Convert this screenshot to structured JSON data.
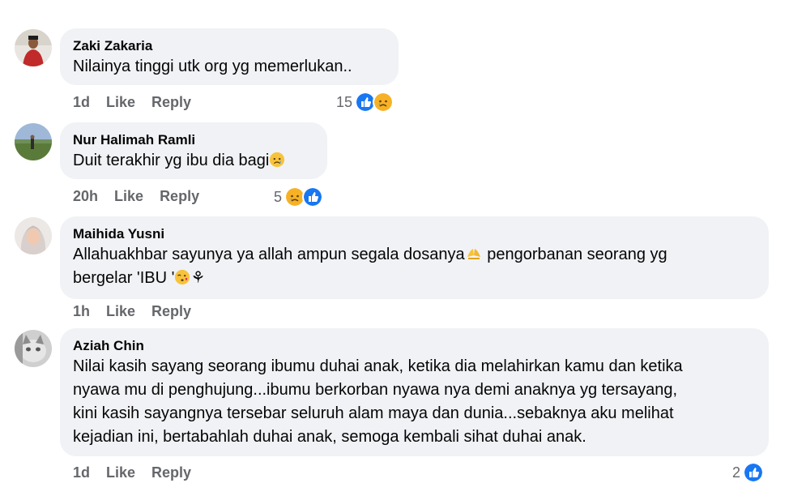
{
  "comments": [
    {
      "author": "Zaki Zakaria",
      "text": "Nilainya tinggi utk org yg memerlukan..",
      "time": "1d",
      "like_label": "Like",
      "reply_label": "Reply",
      "reaction_count": "15",
      "reactions": [
        "like",
        "sad"
      ]
    },
    {
      "author": "Nur Halimah Ramli",
      "text": "Duit terakhir yg ibu dia bagi",
      "text_emoji": "sad-face",
      "time": "20h",
      "like_label": "Like",
      "reply_label": "Reply",
      "reaction_count": "5",
      "reactions": [
        "sad",
        "like"
      ]
    },
    {
      "author": "Maihida Yusni",
      "text_line1": "Allahuakhbar sayunya ya allah ampun segala dosanya",
      "text_line1_emoji": "praying-hands",
      "text_line1_end": " pengorbanan seorang yg",
      "text_line2": "bergelar 'IBU '",
      "text_line2_emoji": "kiss-face",
      "text_line2_end": "⚘",
      "time": "1h",
      "like_label": "Like",
      "reply_label": "Reply"
    },
    {
      "author": "Aziah Chin",
      "text_lines": [
        "Nilai kasih sayang seorang ibumu duhai anak, ketika dia melahirkan kamu dan ketika",
        "nyawa mu di penghujung...ibumu berkorban nyawa nya demi anaknya yg tersayang,",
        "kini kasih sayangnya tersebar seluruh alam maya dan dunia...sebaknya aku melihat",
        "kejadian ini, bertabahlah duhai anak, semoga kembali sihat duhai anak."
      ],
      "time": "1d",
      "like_label": "Like",
      "reply_label": "Reply",
      "reaction_count": "2",
      "reactions": [
        "like"
      ]
    }
  ],
  "colors": {
    "bubble": "#f0f2f5",
    "meta": "#65676b",
    "like_blue": "#1877f2",
    "sad_yellow": "#f7b125"
  }
}
